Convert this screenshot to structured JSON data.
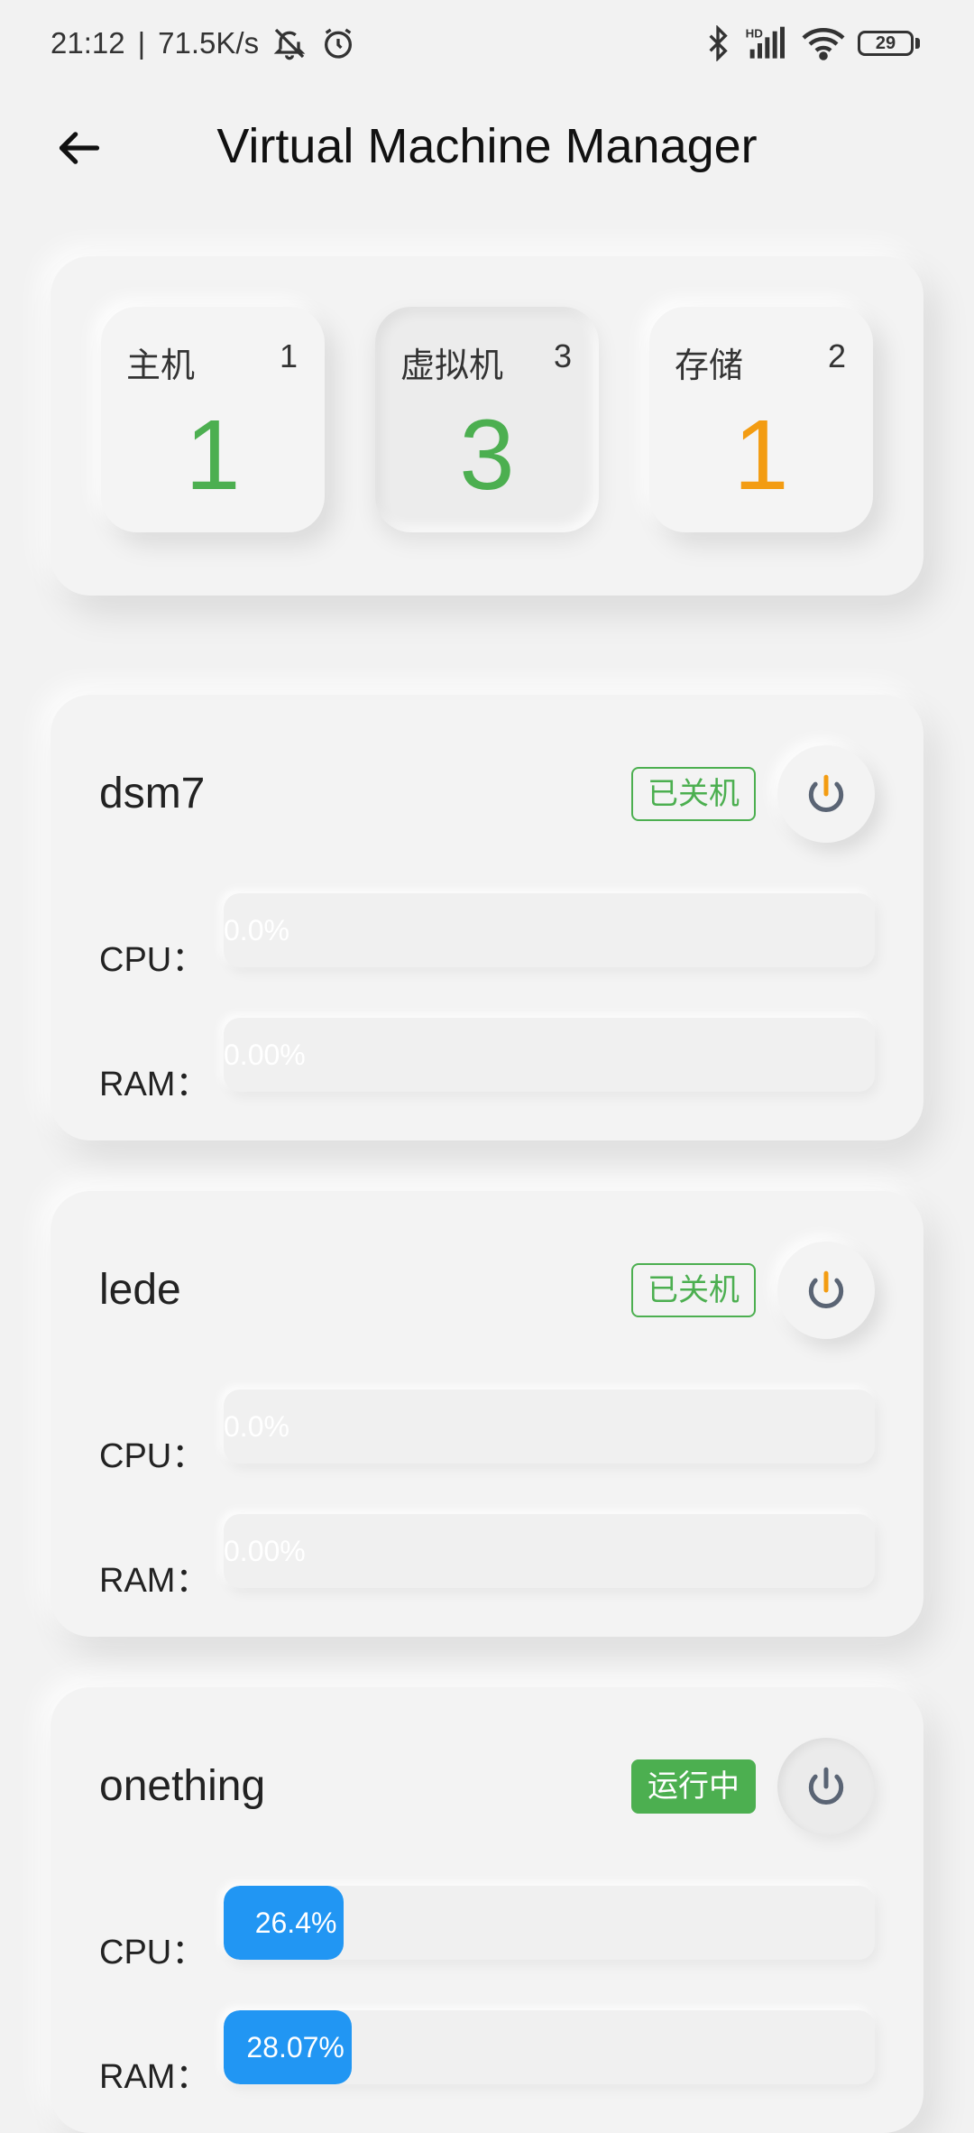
{
  "status_bar": {
    "time": "21:12",
    "network_speed": "71.5K/s",
    "battery": "29",
    "signal_label": "HD"
  },
  "header": {
    "title": "Virtual Machine Manager"
  },
  "summary": {
    "cards": [
      {
        "label": "主机",
        "total": "1",
        "value": "1",
        "color": "#4caf50"
      },
      {
        "label": "虚拟机",
        "total": "3",
        "value": "3",
        "color": "#4caf50"
      },
      {
        "label": "存储",
        "total": "2",
        "value": "1",
        "color": "#f39c12"
      }
    ]
  },
  "vms": [
    {
      "name": "dsm7",
      "status": "已关机",
      "running": false,
      "power_color": "#f39c12",
      "cpu_label": "CPU：",
      "cpu_text": "0.0%",
      "cpu_fraction": 0.0,
      "ram_label": "RAM：",
      "ram_text": "0.00%",
      "ram_fraction": 0.0
    },
    {
      "name": "lede",
      "status": "已关机",
      "running": false,
      "power_color": "#f39c12",
      "cpu_label": "CPU：",
      "cpu_text": "0.0%",
      "cpu_fraction": 0.0,
      "ram_label": "RAM：",
      "ram_text": "0.00%",
      "ram_fraction": 0.0
    },
    {
      "name": "onething",
      "status": "运行中",
      "running": true,
      "power_color": "#5a6474",
      "cpu_label": "CPU：",
      "cpu_text": "26.4%",
      "cpu_fraction": 0.264,
      "ram_label": "RAM：",
      "ram_text": "28.07%",
      "ram_fraction": 0.2807
    }
  ],
  "colors": {
    "accent_green": "#4caf50",
    "accent_orange": "#f39c12",
    "progress_blue": "#2196f3"
  }
}
